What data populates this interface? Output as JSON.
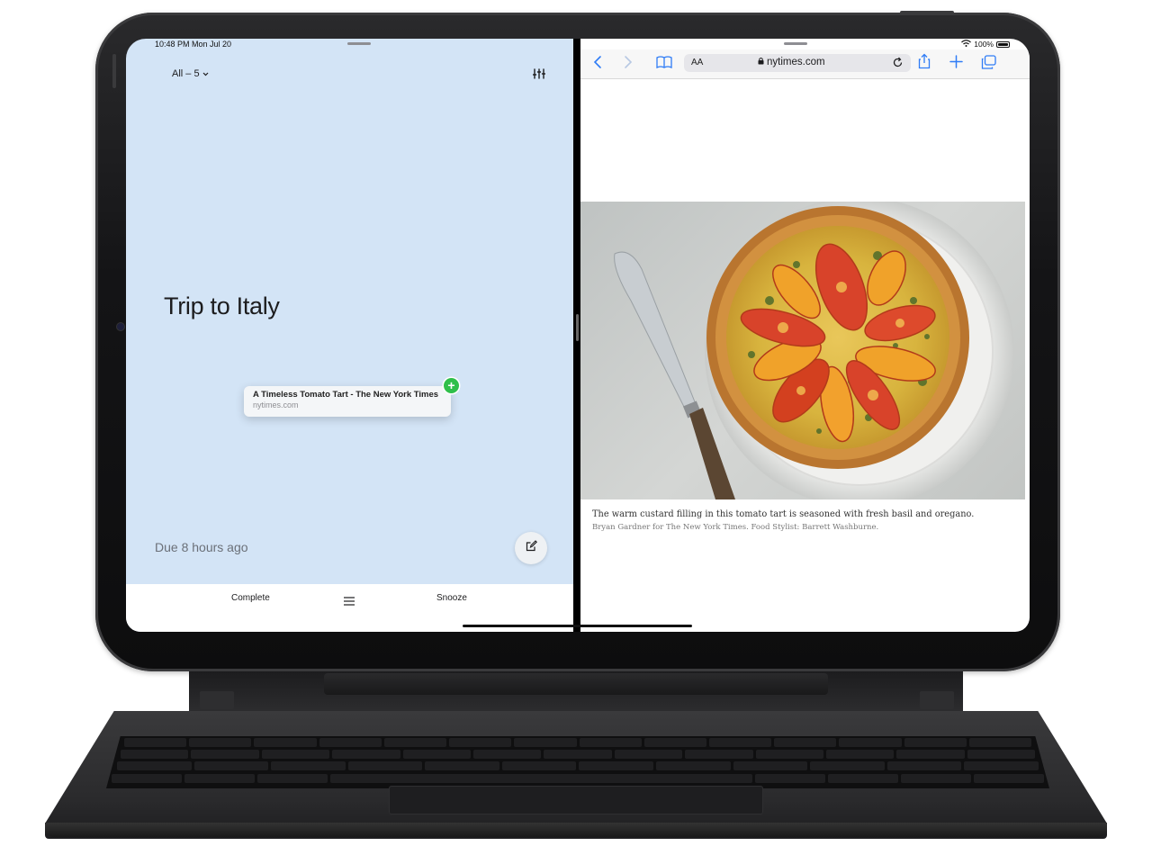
{
  "status_bar": {
    "time_date": "10:48 PM  Mon Jul 20",
    "battery_percent": "100%"
  },
  "reminders": {
    "filter_label": "All – 5",
    "list_title": "Trip to Italy",
    "link_card": {
      "title": "A Timeless Tomato Tart - The New York Times",
      "url": "nytimes.com"
    },
    "add_badge": "+",
    "due_text": "Due 8 hours ago",
    "bottom_bar": {
      "complete_label": "Complete",
      "snooze_label": "Snooze"
    }
  },
  "safari": {
    "text_size_label": "AA",
    "url_domain": "nytimes.com",
    "photo_caption": "The warm custard filling in this tomato tart is seasoned with fresh basil and oregano.",
    "photo_credit": "Bryan Gardner for The New York Times. Food Stylist: Barrett Washburne."
  },
  "icons": {
    "filter": "chevron-down-icon",
    "settings": "sliders-icon",
    "compose": "compose-icon",
    "menu": "hamburger-icon",
    "back": "chevron-left-icon",
    "forward": "chevron-right-icon",
    "bookmarks": "book-icon",
    "lock": "lock-icon",
    "reload": "reload-icon",
    "share": "share-icon",
    "new_tab": "plus-icon",
    "tabs": "tabs-icon",
    "wifi": "wifi-icon",
    "battery": "battery-icon"
  },
  "colors": {
    "reminders_background": "#d3e4f6",
    "add_badge": "#2fbf4a",
    "safari_tint": "#2f7cf6",
    "device_frame": "#141416"
  }
}
